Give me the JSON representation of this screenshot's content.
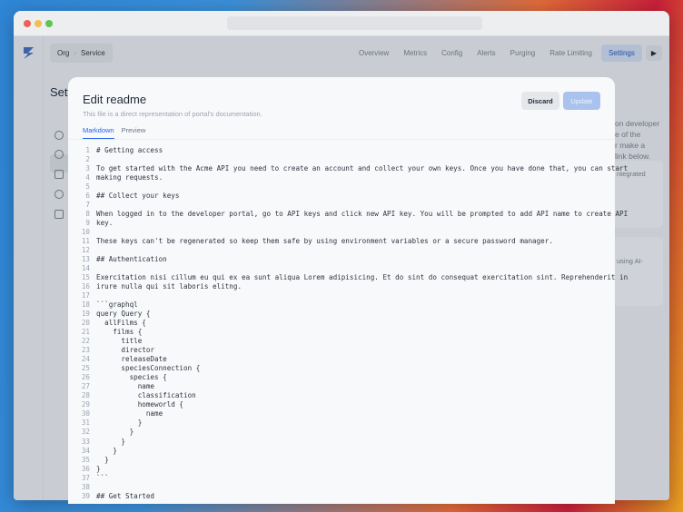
{
  "nav": {
    "breadcrumb": [
      "Org",
      "Service"
    ],
    "items": [
      "Overview",
      "Metrics",
      "Config",
      "Alerts",
      "Purging",
      "Rate Limiting",
      "Settings"
    ],
    "active": "Settings"
  },
  "page": {
    "title_partial": "Sett",
    "desc_partial": [
      "on developer",
      "e of the",
      "r make a",
      "link below."
    ],
    "cards": [
      "ntegrated",
      "using AI-"
    ]
  },
  "modal": {
    "title": "Edit readme",
    "subtitle": "This file is a direct representation of portal's documentation.",
    "tabs": [
      "Markdown",
      "Preview"
    ],
    "discard": "Discard",
    "update": "Update",
    "lines": [
      "# Getting access",
      "",
      "To get started with the Acme API you need to create an account and collect your own keys. Once you have done that, you can start",
      "making requests.",
      "",
      "## Collect your keys",
      "",
      "When logged in to the developer portal, go to API keys and click new API key. You will be prompted to add API name to create API",
      "key.",
      "",
      "These keys can't be regenerated so keep them safe by using environment variables or a secure password manager.",
      "",
      "## Authentication",
      "",
      "Exercitation nisi cillum eu qui ex ea sunt aliqua Lorem adipisicing. Et do sint do consequat exercitation sint. Reprehenderit in",
      "irure nulla qui sit laboris elitng.",
      "",
      "```graphql",
      "query Query {",
      "  allFilms {",
      "    films {",
      "      title",
      "      director",
      "      releaseDate",
      "      speciesConnection {",
      "        species {",
      "          name",
      "          classification",
      "          homeworld {",
      "            name",
      "          }",
      "        }",
      "      }",
      "    }",
      "  }",
      "}",
      "```",
      "",
      "## Get Started"
    ]
  }
}
